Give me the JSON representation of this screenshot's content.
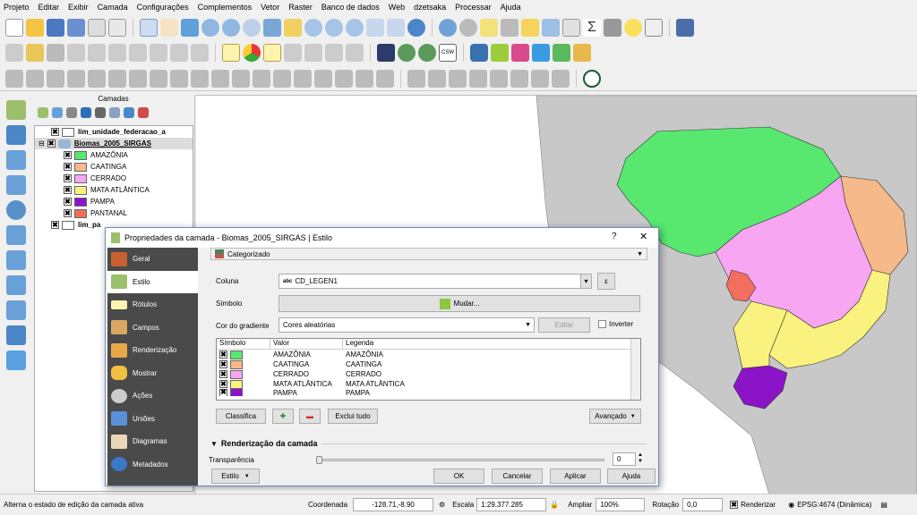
{
  "menu": [
    "Projeto",
    "Editar",
    "Exibir",
    "Camada",
    "Configurações",
    "Complementos",
    "Vetor",
    "Raster",
    "Banco de dados",
    "Web",
    "dzetsaka",
    "Processar",
    "Ajuda"
  ],
  "layers_panel": {
    "title": "Camadas",
    "items": [
      {
        "label": "lim_unidade_federacao_a",
        "checked": true
      },
      {
        "label": "Biomas_2005_SIRGAS",
        "checked": true
      }
    ],
    "classes": [
      {
        "label": "AMAZÔNIA",
        "color": "#58e870"
      },
      {
        "label": "CAATINGA",
        "color": "#f6b98a"
      },
      {
        "label": "CERRADO",
        "color": "#f7a6f2"
      },
      {
        "label": "MATA ATLÂNTICA",
        "color": "#f9f27e"
      },
      {
        "label": "PAMPA",
        "color": "#8c14c8"
      },
      {
        "label": "PANTANAL",
        "color": "#f26e5e"
      }
    ],
    "truncated_layer": "lim_pa"
  },
  "dialog": {
    "title": "Propriedades da camada - Biomas_2005_SIRGAS | Estilo",
    "help": "?",
    "close": "✕",
    "nav": [
      "Geral",
      "Estilo",
      "Rótulos",
      "Campos",
      "Renderização",
      "Mostrar",
      "Ações",
      "Uniões",
      "Diagramas",
      "Metadados"
    ],
    "renderer": "Categorizado",
    "column_label": "Coluna",
    "column_value": "CD_LEGEN1",
    "column_prefix": "abc",
    "symbol_label": "Símbolo",
    "symbol_button": "Mudar...",
    "ramp_label": "Cor do gradiente",
    "ramp_value": "Cores aleatórias",
    "edit_button": "Editar",
    "invert_label": "Inverter",
    "table_headers": [
      "Símbolo",
      "Valor",
      "Legenda"
    ],
    "table_rows": [
      {
        "value": "AMAZÔNIA",
        "legend": "AMAZÔNIA",
        "color": "#58e870"
      },
      {
        "value": "CAATINGA",
        "legend": "CAATINGA",
        "color": "#f6b98a"
      },
      {
        "value": "CERRADO",
        "legend": "CERRADO",
        "color": "#f7a6f2"
      },
      {
        "value": "MATA ATLÂNTICA",
        "legend": "MATA ATLÂNTICA",
        "color": "#f9f27e"
      },
      {
        "value": "PAMPA",
        "legend": "PAMPA",
        "color": "#8c14c8"
      }
    ],
    "classify_button": "Classifica",
    "delete_all_button": "Exclui tudo",
    "advanced_button": "Avançado",
    "layer_render_label": "Renderização da camada",
    "transparency_label": "Transparência",
    "transparency_value": "0",
    "style_button": "Estilo",
    "ok_button": "OK",
    "cancel_button": "Cancelar",
    "apply_button": "Aplicar",
    "help_button": "Ajuda"
  },
  "status": {
    "message": "Alterna o estado de edição da camada ativa",
    "coord_label": "Coordenada",
    "coord_value": "-128.71,-8.90",
    "scale_label": "Escala",
    "scale_value": "1:29.377.285",
    "zoom_label": "Ampliar",
    "zoom_value": "100%",
    "rotation_label": "Rotação",
    "rotation_value": "0,0",
    "render_label": "Renderizar",
    "crs": "EPSG:4674 (Dinâmica)"
  }
}
